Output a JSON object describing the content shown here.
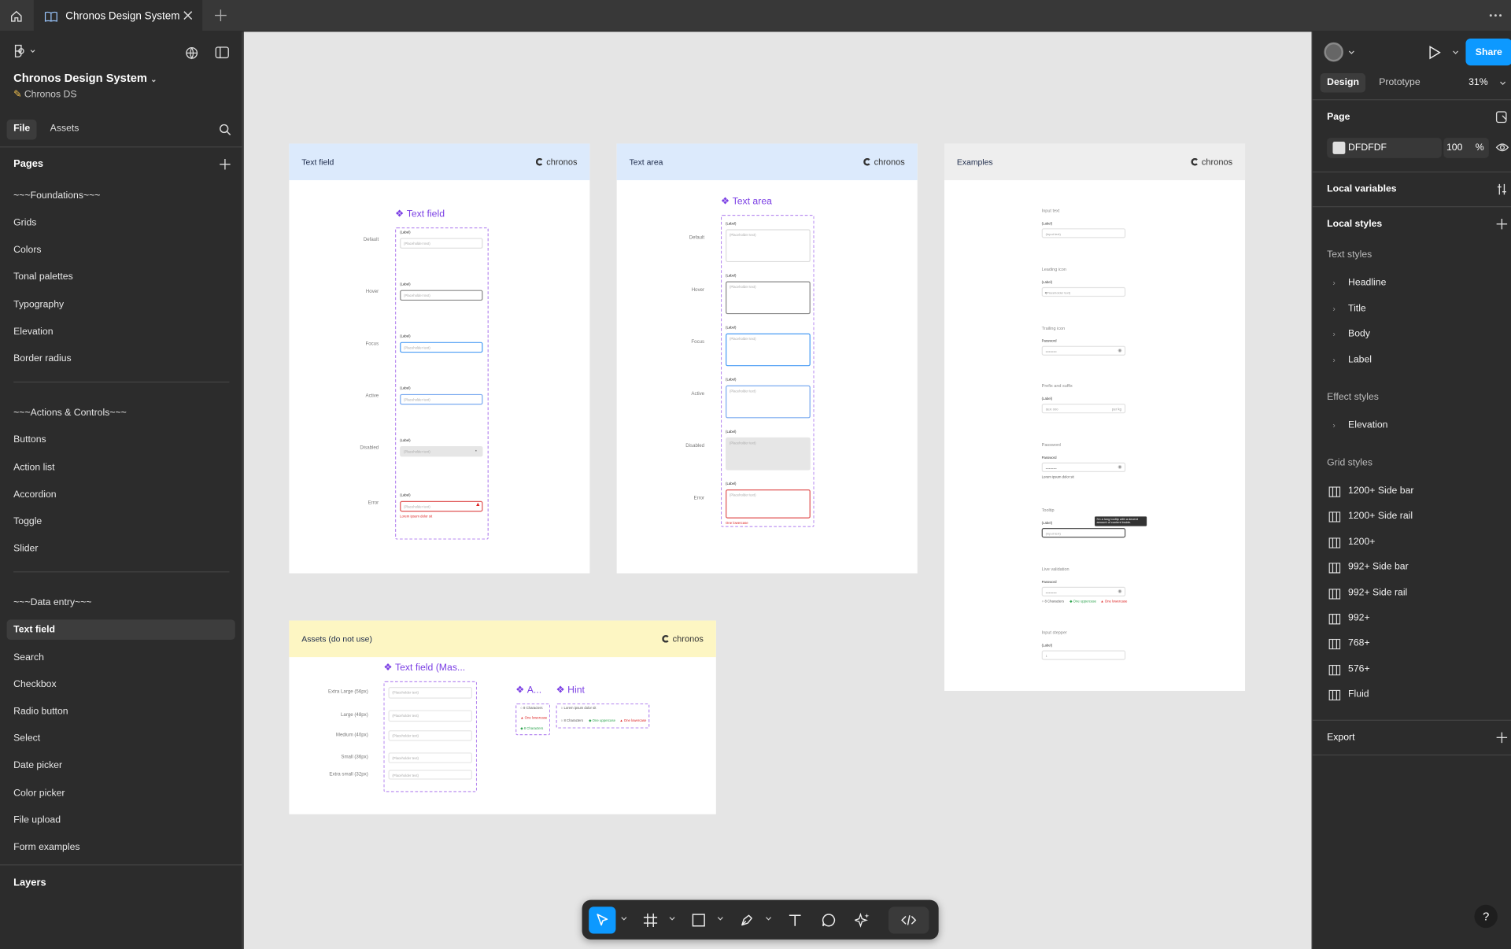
{
  "topbar": {
    "tab_title": "Chronos Design System"
  },
  "file": {
    "name": "Chronos Design System",
    "project": "Chronos DS",
    "tabs": [
      "File",
      "Assets"
    ],
    "pages_heading": "Pages",
    "pages": [
      "~~~Foundations~~~",
      "Grids",
      "Colors",
      "Tonal palettes",
      "Typography",
      "Elevation",
      "Border radius",
      "~~~Actions & Controls~~~",
      "Buttons",
      "Action list",
      "Accordion",
      "Toggle",
      "Slider",
      "~~~Data entry~~~",
      "Text field",
      "Search",
      "Checkbox",
      "Radio button",
      "Select",
      "Date picker",
      "Color picker",
      "File upload",
      "Form examples"
    ],
    "selected_page": "Text field",
    "layers_heading": "Layers"
  },
  "canvas": {
    "background": "#e5e5e5",
    "frames": {
      "text_field": {
        "header": "Text field",
        "logo": "chronos",
        "component": "Text field",
        "states": [
          "Default",
          "Hover",
          "Focus",
          "Active",
          "Disabled",
          "Error"
        ],
        "label": "(Label)",
        "placeholder": "(Placeholder text)",
        "error_msg": "Lorem ipsum dolor sit"
      },
      "text_area": {
        "header": "Text area",
        "logo": "chronos",
        "component": "Text area",
        "states": [
          "Default",
          "Hover",
          "Focus",
          "Active",
          "Disabled",
          "Error"
        ],
        "label": "(Label)",
        "placeholder": "(Placeholder text)",
        "error_msg": "One lowercase"
      },
      "examples": {
        "header": "Examples",
        "logo": "chronos",
        "groups": [
          {
            "title": "Input text",
            "label": "(Label)",
            "value": "(Input text)"
          },
          {
            "title": "Leading icon",
            "label": "(Label)",
            "value": "(Placeholder text)"
          },
          {
            "title": "Trailing icon",
            "label": "Password",
            "value": "••••••••••"
          },
          {
            "title": "Prefix and suffix",
            "label": "(Label)",
            "value": "SEK  000",
            "suffix": "per kg"
          },
          {
            "title": "Password",
            "label": "Password",
            "value": "••••••••••",
            "hint": "Lorem ipsum dolor sit"
          },
          {
            "title": "Tooltip",
            "label": "(Label)",
            "value": "(Input text)",
            "tooltip": "I'm a long tooltip with a decent amount of content inside."
          },
          {
            "title": "Live validation",
            "label": "Password",
            "value": "••••••••••",
            "checks": [
              "8 Characters",
              "One uppercase",
              "One lowercase"
            ]
          },
          {
            "title": "Input stepper",
            "label": "(Label)",
            "value": "1"
          }
        ]
      },
      "assets": {
        "header": "Assets (do not use)",
        "logo": "chronos",
        "component": "Text field (Mas...",
        "sizes": [
          "Extra Large (56px)",
          "Large (48px)",
          "Medium (40px)",
          "Small (36px)",
          "Extra small (32px)"
        ],
        "placeholder": "(Placeholder text)",
        "comp_a": "A...",
        "comp_hint": "Hint",
        "a_items": [
          "8 Characters",
          "One lowercase",
          "8 Characters"
        ],
        "hint_text": "Lorem ipsum dolor sit",
        "hint_items": [
          "8 Characters",
          "One uppercase",
          "One lowercase"
        ]
      }
    }
  },
  "toolbar": {
    "tools": [
      "move-tool",
      "frame-tool",
      "shape-tool",
      "pen-tool",
      "text-tool",
      "comment-tool",
      "actions-tool",
      "dev-mode-toggle"
    ]
  },
  "inspector": {
    "share_label": "Share",
    "tabs": [
      "Design",
      "Prototype"
    ],
    "zoom": "31%",
    "page_heading": "Page",
    "page_color": "DFDFDF",
    "page_opacity": "100",
    "page_opacity_unit": "%",
    "local_variables": "Local variables",
    "local_styles": "Local styles",
    "text_styles_heading": "Text styles",
    "text_styles": [
      "Headline",
      "Title",
      "Body",
      "Label"
    ],
    "effect_styles_heading": "Effect styles",
    "effect_styles": [
      "Elevation"
    ],
    "grid_styles_heading": "Grid styles",
    "grid_styles": [
      "1200+ Side bar",
      "1200+ Side rail",
      "1200+",
      "992+ Side bar",
      "992+ Side rail",
      "992+",
      "768+",
      "576+",
      "Fluid"
    ],
    "export_heading": "Export",
    "help_label": "?"
  },
  "colors": {
    "accent": "#0d99ff",
    "text_field_header": "#dceafc",
    "assets_header": "#fdf6c3",
    "examples_header": "#eeeeee",
    "component_purple": "#7b3fe4",
    "error_red": "#d22222",
    "success_green": "#2ea44f"
  }
}
